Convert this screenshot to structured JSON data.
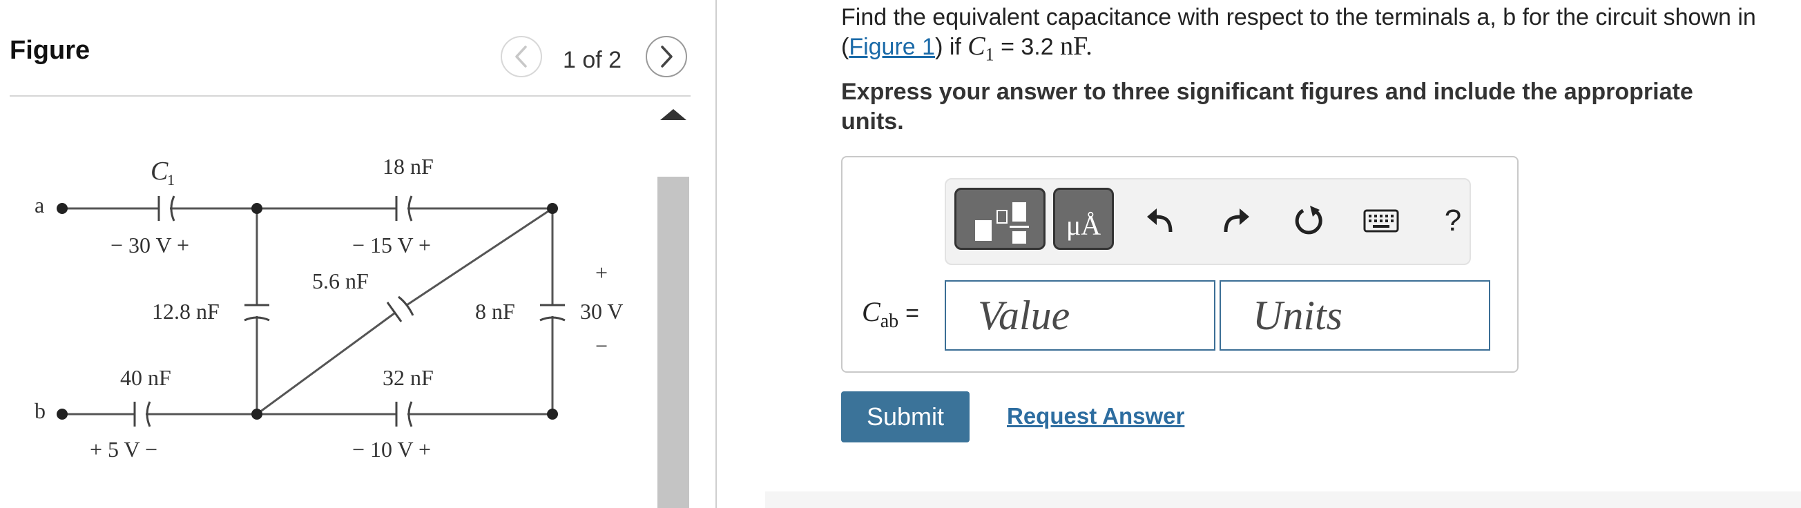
{
  "figure": {
    "title": "Figure",
    "page_indicator": "1 of 2",
    "prev_icon": "chevron-left-icon",
    "next_icon": "chevron-right-icon",
    "scroll_icon": "triangle-up-icon",
    "circuit": {
      "terminal_a": "a",
      "terminal_b": "b",
      "c1_label": "C",
      "c1_sub": "1",
      "c1_voltage": "−  30 V  +",
      "c18_label": "18 nF",
      "c18_voltage": "−  15 V  +",
      "c12_label": "12.8 nF",
      "c56_label": "5.6 nF",
      "c8_label": "8 nF",
      "c8_voltage": "30 V",
      "c8_plus": "+",
      "c8_minus": "−",
      "c40_label": "40 nF",
      "c40_voltage": "+  5 V  −",
      "c32_label": "32 nF",
      "c32_voltage": "−  10 V  +"
    }
  },
  "question": {
    "line1": "Find the equivalent capacitance with respect to the terminals a, b for the circuit shown in",
    "open_paren": "(",
    "figure_link": "Figure 1",
    "line2_after": ") if ",
    "c_var": "C",
    "c_sub": "1",
    "c_value": " = 3.2 ",
    "c_unit": "nF",
    "period": ".",
    "instructions": "Express your answer to three significant figures and include the appropriate units."
  },
  "answer": {
    "label_var": "C",
    "label_sub": "ab",
    "equals": "=",
    "value_placeholder": "Value",
    "units_placeholder": "Units",
    "units_button": "μÅ",
    "help": "?"
  },
  "actions": {
    "submit": "Submit",
    "request_answer": "Request Answer"
  },
  "icons": {
    "template": "template-icon",
    "undo": "undo-icon",
    "redo": "redo-icon",
    "reset": "reset-icon",
    "keyboard": "keyboard-icon"
  },
  "colors": {
    "link": "#1a6aa8",
    "submit_bg": "#3b7399",
    "field_border": "#3b6e95"
  }
}
